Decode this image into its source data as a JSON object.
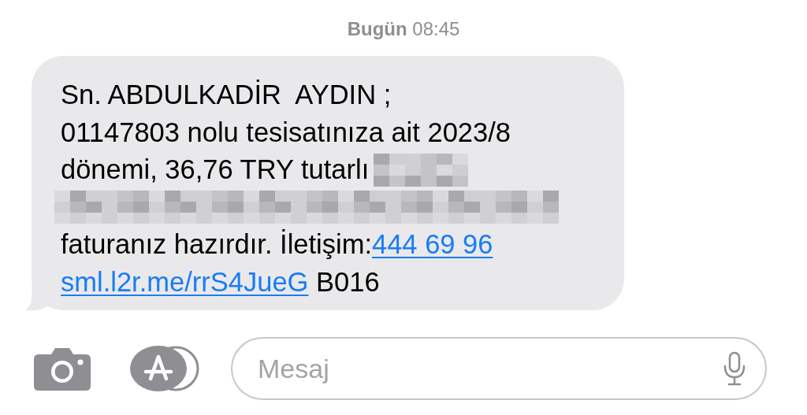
{
  "timestamp": {
    "day": "Bugün",
    "time": "08:45"
  },
  "message": {
    "lines": [
      [
        {
          "kind": "text",
          "text": "Sn. ABDULKADİR  AYDIN ;"
        }
      ],
      [
        {
          "kind": "text",
          "text": "01147803 nolu tesisatınıza ait 2023/8"
        }
      ],
      [
        {
          "kind": "text",
          "text": "dönemi, 36,76 TRY tutarlı"
        },
        {
          "kind": "redacted_word"
        }
      ],
      [
        {
          "kind": "redacted_line"
        }
      ],
      [
        {
          "kind": "text",
          "text": "faturanız hazırdır. İletişim:"
        },
        {
          "kind": "link",
          "text": "444 69 96"
        }
      ],
      [
        {
          "kind": "link",
          "text": "sml.l2r.me/rrS4JueG"
        },
        {
          "kind": "text",
          "text": " B016"
        }
      ]
    ]
  },
  "compose": {
    "placeholder": "Mesaj"
  }
}
